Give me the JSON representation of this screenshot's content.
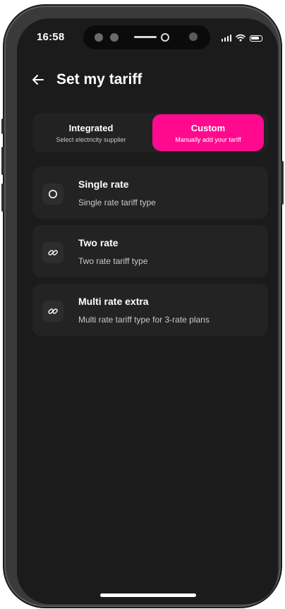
{
  "status_bar": {
    "time": "16:58"
  },
  "header": {
    "title": "Set my tariff",
    "back_icon": "arrow-left-icon"
  },
  "tabs": [
    {
      "label": "Integrated",
      "description": "Select electricity supplier",
      "selected": false
    },
    {
      "label": "Custom",
      "description": "Manually add your tariff",
      "selected": true
    }
  ],
  "options": [
    {
      "title": "Single rate",
      "description": "Single rate tariff type",
      "icon": "circle-icon"
    },
    {
      "title": "Two rate",
      "description": "Two rate tariff type",
      "icon": "link-icon"
    },
    {
      "title": "Multi rate extra",
      "description": "Multi rate tariff type for 3-rate plans",
      "icon": "link-icon"
    }
  ],
  "colors": {
    "accent": "#ff0a8f",
    "background": "#1b1b1b",
    "card": "#232323",
    "text_primary": "#ffffff",
    "text_secondary": "#c9c9c9"
  }
}
